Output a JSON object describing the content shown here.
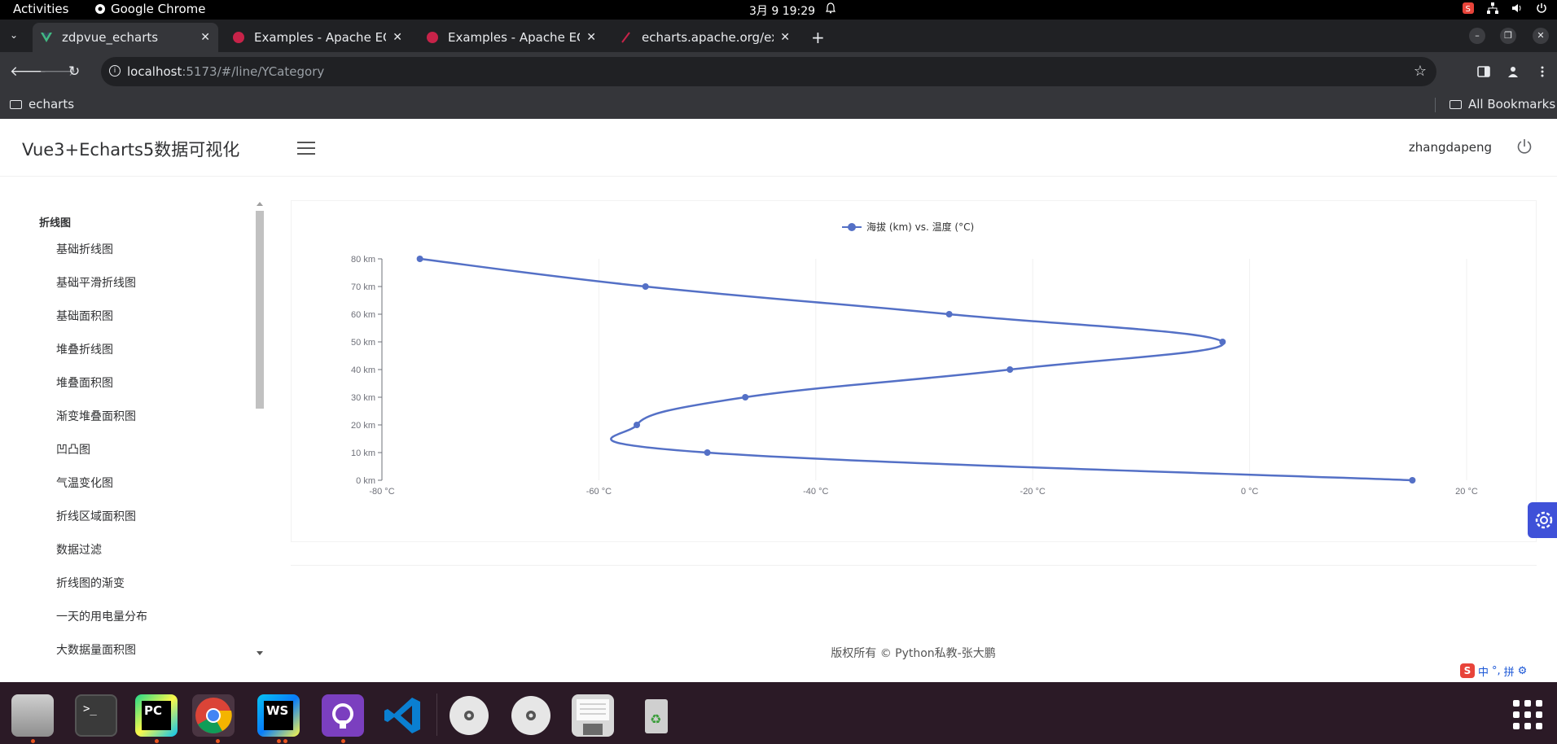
{
  "system_bar": {
    "activities": "Activities",
    "app_name": "Google Chrome",
    "clock": "3月 9  19:29"
  },
  "browser": {
    "tabs": [
      {
        "label": "zdpvue_echarts",
        "active": true,
        "favicon_color": "#42b883"
      },
      {
        "label": "Examples - Apache ECha",
        "active": false,
        "favicon_color": "#c72349"
      },
      {
        "label": "Examples - Apache ECha",
        "active": false,
        "favicon_color": "#c72349"
      },
      {
        "label": "echarts.apache.org/exa",
        "active": false,
        "favicon_color": "#c72349"
      }
    ],
    "url_host": "localhost",
    "url_rest": ":5173/#/line/YCategory",
    "bookmarks": {
      "left": "echarts",
      "right": "All Bookmarks"
    }
  },
  "app": {
    "title": "Vue3+Echarts5数据可视化",
    "username": "zhangdapeng",
    "copyright": "版权所有 © Python私教-张大鹏"
  },
  "sidebar": {
    "group": "折线图",
    "items": [
      {
        "label": "基础折线图"
      },
      {
        "label": "基础平滑折线图"
      },
      {
        "label": "基础面积图"
      },
      {
        "label": "堆叠折线图"
      },
      {
        "label": "堆叠面积图"
      },
      {
        "label": "渐变堆叠面积图"
      },
      {
        "label": "凹凸图"
      },
      {
        "label": "气温变化图"
      },
      {
        "label": "折线区域面积图"
      },
      {
        "label": "数据过滤"
      },
      {
        "label": "折线图的渐变"
      },
      {
        "label": "一天的用电量分布"
      },
      {
        "label": "大数据量面积图"
      }
    ]
  },
  "chart_data": {
    "type": "line",
    "legend": [
      "海拔 (km) vs. 温度 (°C)"
    ],
    "legend_position": "top-center",
    "x_axis": {
      "ticks": [
        "-80 °C",
        "-60 °C",
        "-40 °C",
        "-20 °C",
        "0 °C",
        "20 °C"
      ],
      "range": [
        -80,
        20
      ],
      "unit": "°C"
    },
    "y_axis": {
      "ticks": [
        "0 km",
        "10 km",
        "20 km",
        "30 km",
        "40 km",
        "50 km",
        "60 km",
        "70 km",
        "80 km"
      ],
      "range": [
        0,
        80
      ],
      "unit": "km"
    },
    "smooth": true,
    "grid": true,
    "series": [
      {
        "name": "海拔 (km) vs. 温度 (°C)",
        "color": "#5470c6",
        "points": [
          {
            "x": 15,
            "y": 0
          },
          {
            "x": -50,
            "y": 10
          },
          {
            "x": -56.5,
            "y": 20
          },
          {
            "x": -46.5,
            "y": 30
          },
          {
            "x": -22.1,
            "y": 40
          },
          {
            "x": -2.5,
            "y": 50
          },
          {
            "x": -27.7,
            "y": 60
          },
          {
            "x": -55.7,
            "y": 70
          },
          {
            "x": -76.5,
            "y": 80
          }
        ]
      }
    ]
  }
}
